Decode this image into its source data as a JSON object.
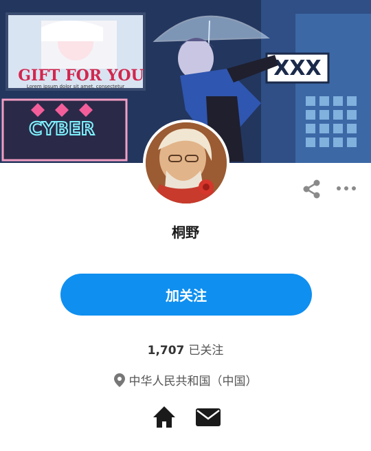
{
  "banner": {
    "sign_text": "GIFT FOR YOU",
    "sign_subtext": "Lorem ipsum dolor sit amet, consectetur",
    "neon_text": "CYBER"
  },
  "profile": {
    "name": "桐野",
    "follow_label": "加关注",
    "following_count": "1,707",
    "following_label": "已关注",
    "location": "中华人民共和国（中国）"
  },
  "icons": {
    "share": "share-icon",
    "more": "more-icon",
    "location": "location-pin-icon",
    "home": "home-icon",
    "mail": "mail-icon"
  },
  "colors": {
    "accent": "#0f8ff0",
    "icon_gray": "#8a8a8a",
    "icon_dark": "#1a1a1a"
  }
}
